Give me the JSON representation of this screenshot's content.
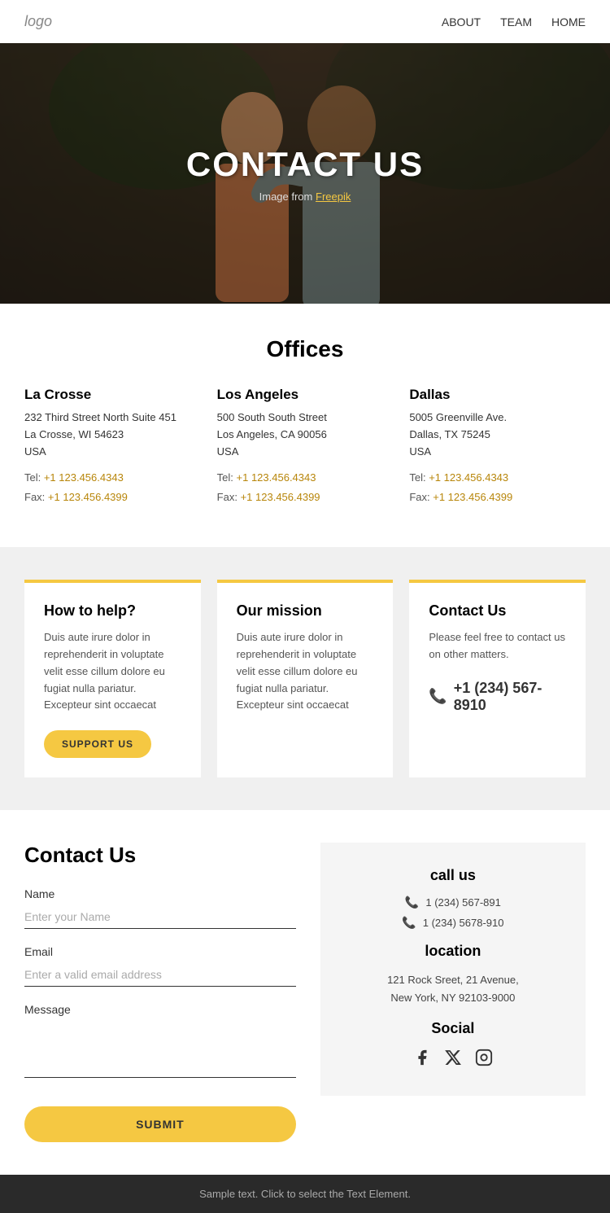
{
  "nav": {
    "logo": "logo",
    "links": [
      {
        "label": "ABOUT",
        "id": "about"
      },
      {
        "label": "TEAM",
        "id": "team"
      },
      {
        "label": "HOME",
        "id": "home"
      }
    ]
  },
  "hero": {
    "title": "CONTACT US",
    "image_credit": "Image from",
    "image_source": "Freepik"
  },
  "offices": {
    "section_title": "Offices",
    "locations": [
      {
        "name": "La Crosse",
        "address": "232 Third Street North Suite 451\nLa Crosse, WI 54623\nUSA",
        "tel": "+1 123.456.4343",
        "fax": "+1 123.456.4399"
      },
      {
        "name": "Los Angeles",
        "address": "500 South South Street\nLos Angeles, CA 90056\nUSA",
        "tel": "+1 123.456.4343",
        "fax": "+1 123.456.4399"
      },
      {
        "name": "Dallas",
        "address": "5005 Greenville Ave.\nDallas, TX 75245\nUSA",
        "tel": "+1 123.456.4343",
        "fax": "+1 123.456.4399"
      }
    ]
  },
  "info_cards": [
    {
      "title": "How to help?",
      "text": "Duis aute irure dolor in reprehenderit in voluptate velit esse cillum dolore eu fugiat nulla pariatur. Excepteur sint occaecat",
      "button": "SUPPORT US"
    },
    {
      "title": "Our mission",
      "text": "Duis aute irure dolor in reprehenderit in voluptate velit esse cillum dolore eu fugiat nulla pariatur. Excepteur sint occaecat",
      "button": null
    },
    {
      "title": "Contact Us",
      "text": "Please feel free to contact us on other matters.",
      "phone": "+1 (234) 567-8910",
      "button": null
    }
  ],
  "contact_form": {
    "title": "Contact Us",
    "name_label": "Name",
    "name_placeholder": "Enter your Name",
    "email_label": "Email",
    "email_placeholder": "Enter a valid email address",
    "message_label": "Message",
    "submit_button": "SUBMIT"
  },
  "contact_info": {
    "call_us_title": "call us",
    "phones": [
      "1 (234) 567-891",
      "1 (234) 5678-910"
    ],
    "location_title": "location",
    "address_line1": "121 Rock Sreet, 21 Avenue,",
    "address_line2": "New York, NY 92103-9000",
    "social_title": "Social",
    "social_icons": [
      "facebook",
      "x-twitter",
      "instagram"
    ]
  },
  "footer": {
    "text": "Sample text. Click to select the Text Element."
  }
}
